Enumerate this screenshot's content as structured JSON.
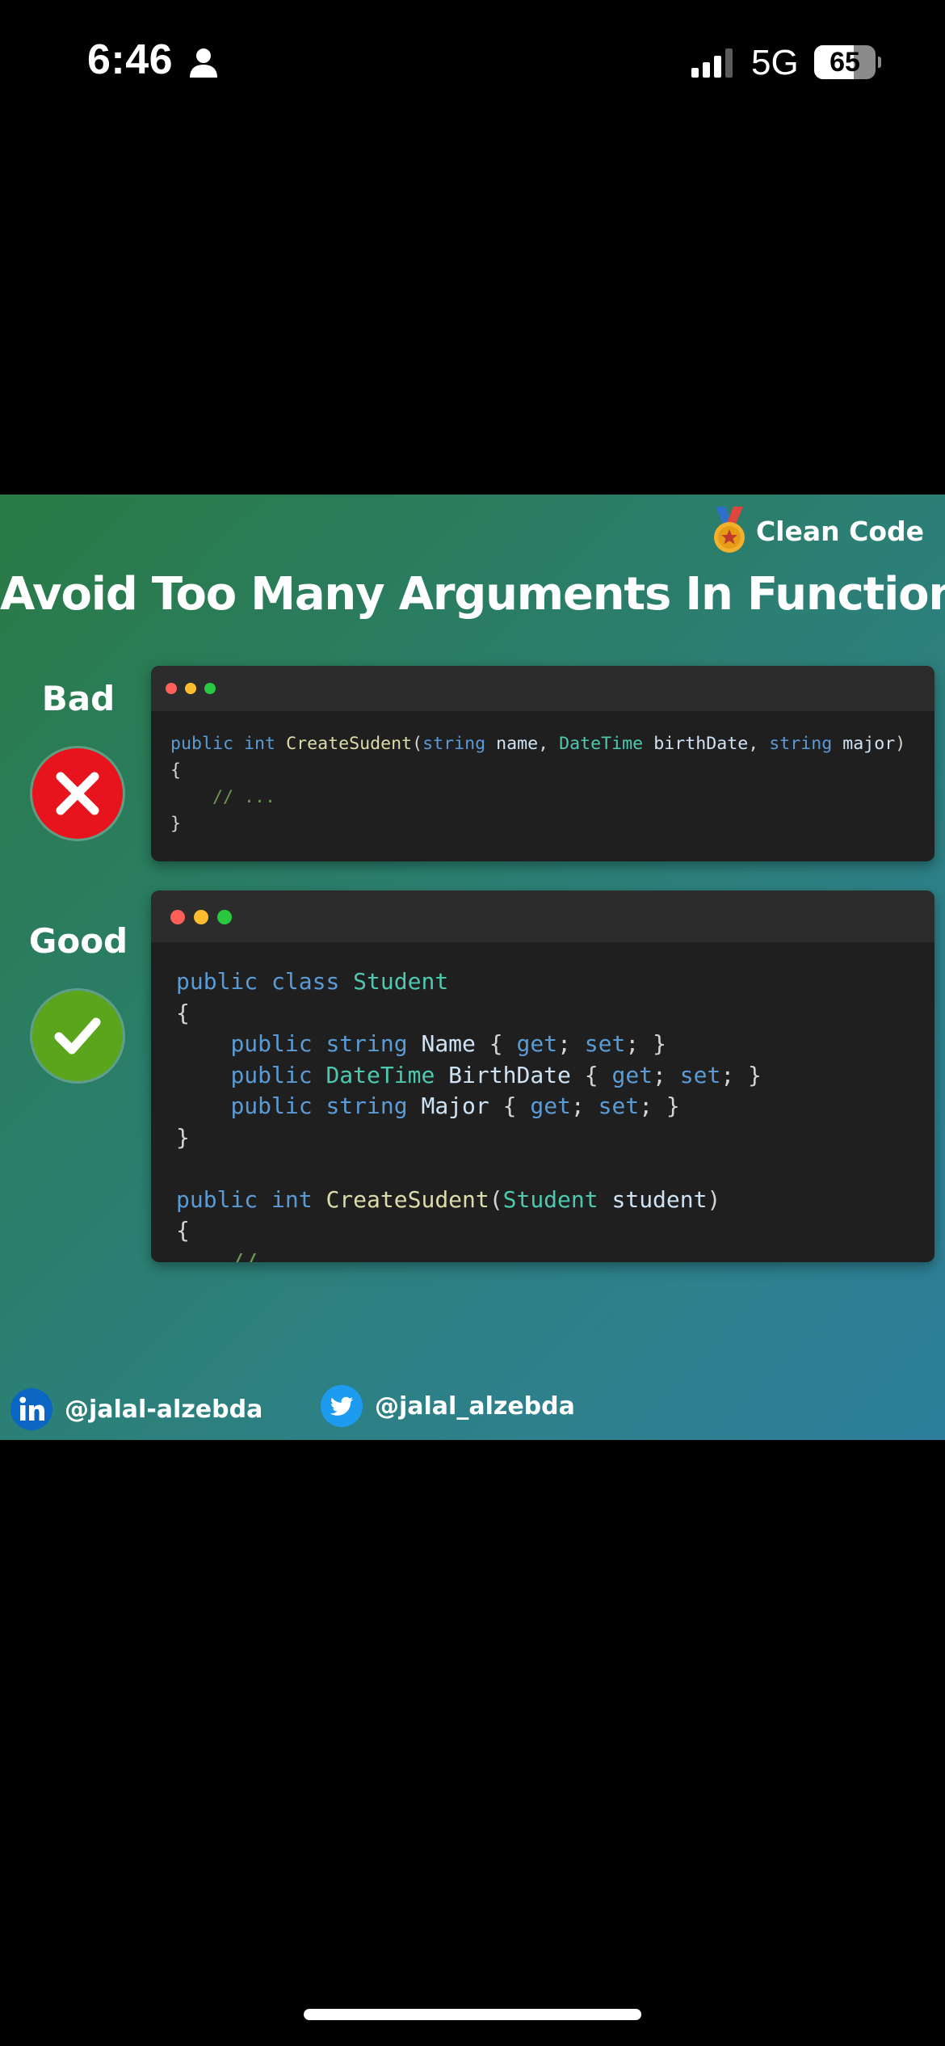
{
  "status_bar": {
    "time": "6:46",
    "network": "5G",
    "battery_level": "65",
    "battery_fraction": 0.65
  },
  "post": {
    "brand_label": "Clean Code",
    "title": "Avoid Too Many Arguments In Functions",
    "bad": {
      "label": "Bad",
      "code_lines": [
        "public int CreateSudent(string name, DateTime birthDate, string major)",
        "{",
        "    // ...",
        "}"
      ]
    },
    "good": {
      "label": "Good",
      "code_lines": [
        "public class Student",
        "{",
        "    public string Name { get; set; }",
        "    public DateTime BirthDate { get; set; }",
        "    public string Major { get; set; }",
        "}",
        "",
        "public int CreateSudent(Student student)",
        "{",
        "    // ...",
        "}"
      ]
    },
    "social": {
      "linkedin_handle": "@jalal-alzebda",
      "twitter_handle": "@jalal_alzebda"
    }
  },
  "colors": {
    "keyword": "#5b9bd5",
    "type": "#4ec9b0",
    "function": "#dcdcaa",
    "comment": "#6a9955",
    "bad_badge": "#e8141d",
    "good_badge": "#5aa51c",
    "dot_red": "#ff5f57",
    "dot_yellow": "#febc2e",
    "dot_green": "#28c840"
  },
  "icons": {
    "status": [
      "person-icon",
      "signal-bars-icon",
      "battery-icon"
    ],
    "brand": "medal-icon",
    "bad": "x-icon",
    "good": "checkmark-icon",
    "social": [
      "linkedin-icon",
      "twitter-icon"
    ]
  }
}
